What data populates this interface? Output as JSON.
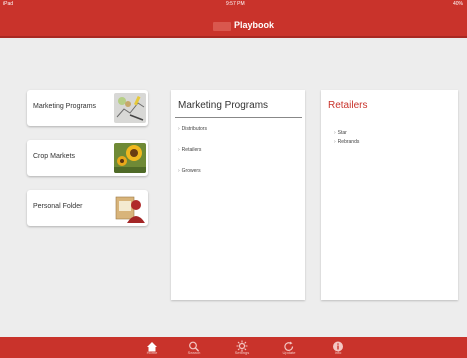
{
  "status_bar": {
    "left": "iPad",
    "time": "9:57 PM",
    "right": "40%"
  },
  "nav": {
    "title": "Playbook"
  },
  "menu": [
    {
      "label": "Marketing Programs",
      "icon": "marketing-icon"
    },
    {
      "label": "Crop Markets",
      "icon": "sunflower-icon"
    },
    {
      "label": "Personal Folder",
      "icon": "folder-person-icon"
    }
  ],
  "programs_panel": {
    "title": "Marketing Programs",
    "items": [
      "Distributors",
      "Retailers",
      "Growers"
    ]
  },
  "retailers_panel": {
    "title": "Retailers",
    "items": [
      "Star",
      "Rebrands"
    ]
  },
  "tabs": [
    {
      "label": "Home",
      "icon": "home-icon"
    },
    {
      "label": "Search",
      "icon": "search-icon"
    },
    {
      "label": "Settings",
      "icon": "gear-icon"
    },
    {
      "label": "Update",
      "icon": "refresh-icon"
    },
    {
      "label": "Info",
      "icon": "info-icon"
    }
  ],
  "colors": {
    "accent": "#c9332b",
    "background": "#ededed"
  }
}
